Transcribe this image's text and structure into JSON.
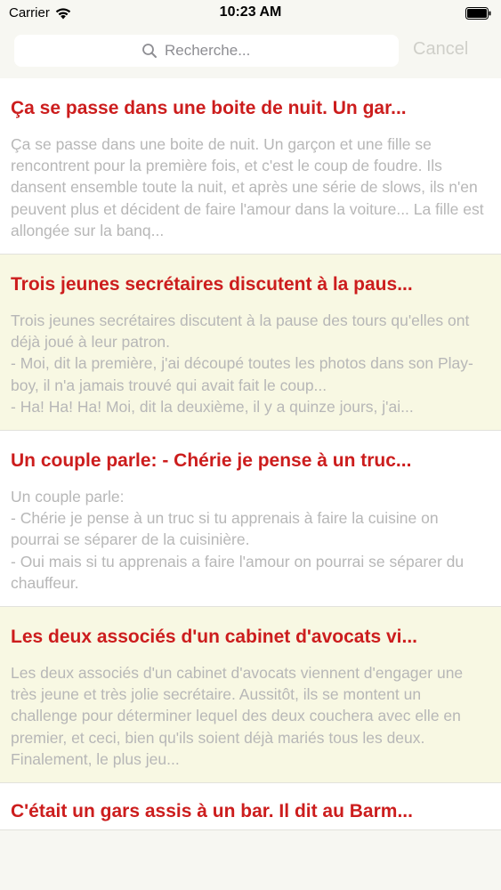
{
  "status_bar": {
    "carrier": "Carrier",
    "time": "10:23 AM"
  },
  "search": {
    "placeholder": "Recherche...",
    "cancel_label": "Cancel"
  },
  "colors": {
    "title_red": "#cc1d1d",
    "preview_gray": "#b7b7b7",
    "row_alt": "#f8f8e3"
  },
  "items": [
    {
      "title": "Ça se passe dans une boite de nuit. Un gar...",
      "preview": "Ça se passe dans une boite de nuit. Un garçon et une fille se rencontrent pour la première fois, et c'est le coup de foudre. Ils dansent ensemble toute la nuit, et après une série de slows, ils n'en peuvent plus et décident de faire l'amour dans la voiture... La fille est allongée sur la banq..."
    },
    {
      "title": "Trois jeunes secrétaires discutent à la paus...",
      "preview": "Trois jeunes secrétaires discutent à la pause des tours qu'elles ont déjà joué à leur patron.\n- Moi, dit la première, j'ai découpé toutes les photos dans son Play-boy, il n'a jamais trouvé qui avait fait le coup...\n- Ha! Ha! Ha! Moi, dit la deuxième, il y a quinze jours, j'ai..."
    },
    {
      "title": "Un couple parle: - Chérie je pense à un truc...",
      "preview": "Un couple parle:\n- Chérie je pense à un truc si tu apprenais à faire la cuisine on pourrai se séparer de la cuisinière.\n- Oui mais si tu apprenais a faire l'amour on pourrai se séparer du chauffeur."
    },
    {
      "title": "Les deux associés d'un cabinet d'avocats vi...",
      "preview": "Les deux associés d'un cabinet d'avocats viennent d'engager une très jeune et très jolie secrétaire. Aussitôt, ils se montent un challenge pour déterminer lequel des deux couchera avec elle en premier, et ceci, bien qu'ils soient déjà mariés tous les deux. Finalement, le plus jeu..."
    },
    {
      "title": "C'était un gars assis à un bar. Il dit au Barm..."
    }
  ]
}
